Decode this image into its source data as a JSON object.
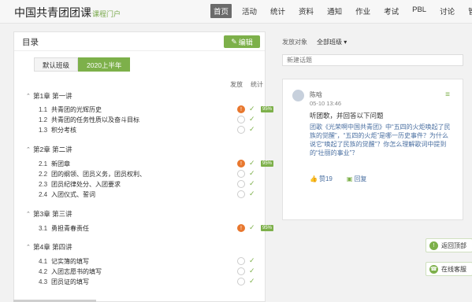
{
  "header": {
    "brand": "中国共青团团课",
    "brand_sub": "课程门户",
    "nav": [
      "首页",
      "活动",
      "统计",
      "资料",
      "通知",
      "作业",
      "考试",
      "PBL",
      "讨论",
      "管理"
    ],
    "active_nav": "首页"
  },
  "catalog": {
    "title": "目录",
    "edit_label": "编辑",
    "tabs": [
      "默认班级",
      "2020上半年"
    ],
    "active_tab": "2020上半年",
    "col_publish": "发放",
    "col_stats": "统计",
    "chapters": [
      {
        "title": "第1章 第一讲",
        "lessons": [
          {
            "num": "1.1",
            "title": "共青团的光辉历史",
            "status": "issue",
            "pct": "95%"
          },
          {
            "num": "1.2",
            "title": "共青团的任务性质以及奋斗目标",
            "status": "empty",
            "pct": ""
          },
          {
            "num": "1.3",
            "title": "积分考核",
            "status": "empty",
            "pct": ""
          }
        ]
      },
      {
        "title": "第2章 第二讲",
        "lessons": [
          {
            "num": "2.1",
            "title": "新团章",
            "status": "issue",
            "pct": "95%"
          },
          {
            "num": "2.2",
            "title": "团的纲领、团员义务，团员权利、",
            "status": "empty",
            "pct": ""
          },
          {
            "num": "2.3",
            "title": "团员纪律处分、入团要求",
            "status": "empty",
            "pct": ""
          },
          {
            "num": "2.4",
            "title": "入团仪式、誓词",
            "status": "empty",
            "pct": ""
          }
        ]
      },
      {
        "title": "第3章 第三讲",
        "lessons": [
          {
            "num": "3.1",
            "title": "勇担青春责任",
            "status": "issue",
            "pct": "95%"
          }
        ]
      },
      {
        "title": "第4章 第四讲",
        "lessons": [
          {
            "num": "4.1",
            "title": "记实簿的填写",
            "status": "empty",
            "pct": ""
          },
          {
            "num": "4.2",
            "title": "入团志愿书的填写",
            "status": "empty",
            "pct": ""
          },
          {
            "num": "4.3",
            "title": "团员证的填写",
            "status": "empty",
            "pct": ""
          }
        ]
      }
    ]
  },
  "discussion": {
    "topic_label": "发放对象",
    "topic_value": "全部班级 ▾",
    "input_placeholder": "新建话题",
    "post": {
      "author": "陈晗",
      "time": "05-10 13:46",
      "title": "听团歌，并回答以下问题",
      "body": "团歌《光荣啊中国共青团》中“五四的火炬唤起了民族的觉醒”，“五四的火炬”是哪一历史事件？为什么说它“唤起了民族的觉醒”？你怎么理解歌词中提到的“壮丽的事业”？",
      "likes": "赞19",
      "reply": "回复"
    }
  },
  "floating": {
    "back_top": "返回顶部",
    "online_help": "在线客服"
  },
  "colors": {
    "accent": "#7db04a",
    "warning": "#e8772e",
    "link": "#4a6fa1"
  }
}
